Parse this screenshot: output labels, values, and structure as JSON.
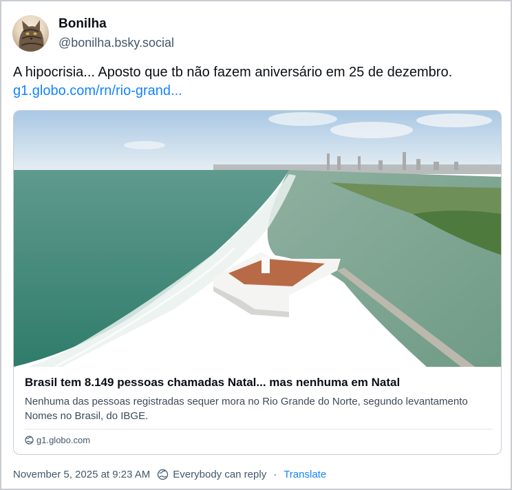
{
  "author": {
    "display_name": "Bonilha",
    "handle": "@bonilha.bsky.social",
    "avatar_icon": "cat-avatar"
  },
  "post": {
    "text": "A hipocrisia... Aposto que tb não fazem aniversário em 25 de dezembro.",
    "link_text": "g1.globo.com/rn/rio-grand..."
  },
  "link_card": {
    "title": "Brasil tem 8.149 pessoas chamadas Natal... mas nenhuma em Natal",
    "description": "Nenhuma das pessoas registradas sequer mora no Rio Grande do Norte, segundo levantamento Nomes no Brasil, do IBGE.",
    "domain": "g1.globo.com",
    "image_icon": "aerial-fort-photo"
  },
  "footer": {
    "timestamp": "November 5, 2025 at 9:23 AM",
    "reply_setting": "Everybody can reply",
    "separator": "·",
    "translate": "Translate"
  },
  "colors": {
    "link": "#1083fe",
    "muted": "#42576c",
    "border": "#c9ccd1"
  }
}
